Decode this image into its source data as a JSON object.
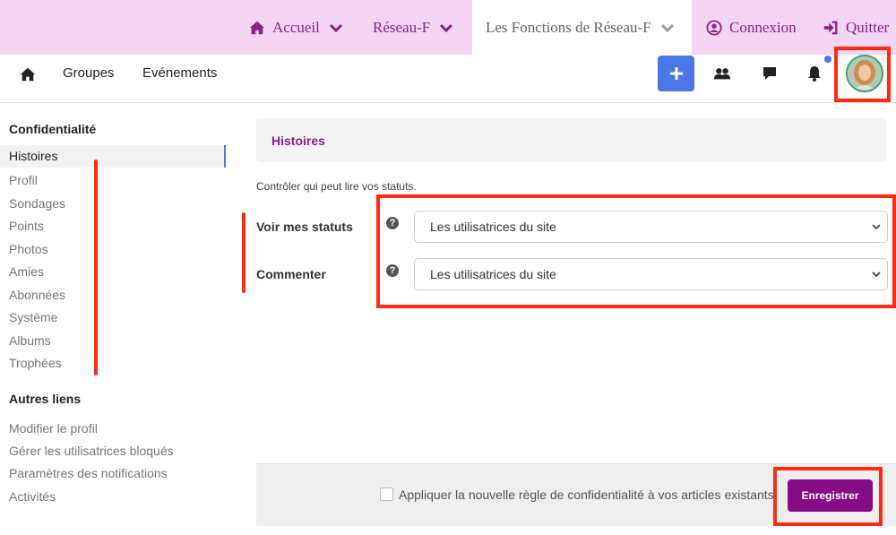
{
  "topnav": {
    "accueil": "Accueil",
    "reseau": "Réseau-F",
    "fonctions": "Les Fonctions de Réseau-F",
    "connexion": "Connexion",
    "quitter": "Quitter"
  },
  "subnav": {
    "groupes": "Groupes",
    "evenements": "Evénements",
    "plus": "+"
  },
  "sidebar": {
    "section1": "Confidentialité",
    "items": [
      "Histoires",
      "Profil",
      "Sondages",
      "Points",
      "Photos",
      "Amies",
      "Abonnées",
      "Système",
      "Albums",
      "Trophées"
    ],
    "section2": "Autres liens",
    "links": [
      "Modifier le profil",
      "Gérer les utilisatrices bloqués",
      "Paramètres des notifications",
      "Activités"
    ]
  },
  "main": {
    "title": "Histoires",
    "description": "Contrôler qui peut lire vos statuts.",
    "fields": [
      {
        "label": "Voir mes statuts",
        "help": "?",
        "value": "Les utilisatrices du site"
      },
      {
        "label": "Commenter",
        "help": "?",
        "value": "Les utilisatrices du site"
      }
    ]
  },
  "footer": {
    "checkbox_label": "Appliquer la nouvelle règle de confidentialité à vos articles existants",
    "save_label": "Enregistrer"
  },
  "colors": {
    "brand": "#870b87",
    "topbar": "#f4d6f4",
    "accent": "#4a76e6",
    "annotation": "#ff2a12"
  }
}
